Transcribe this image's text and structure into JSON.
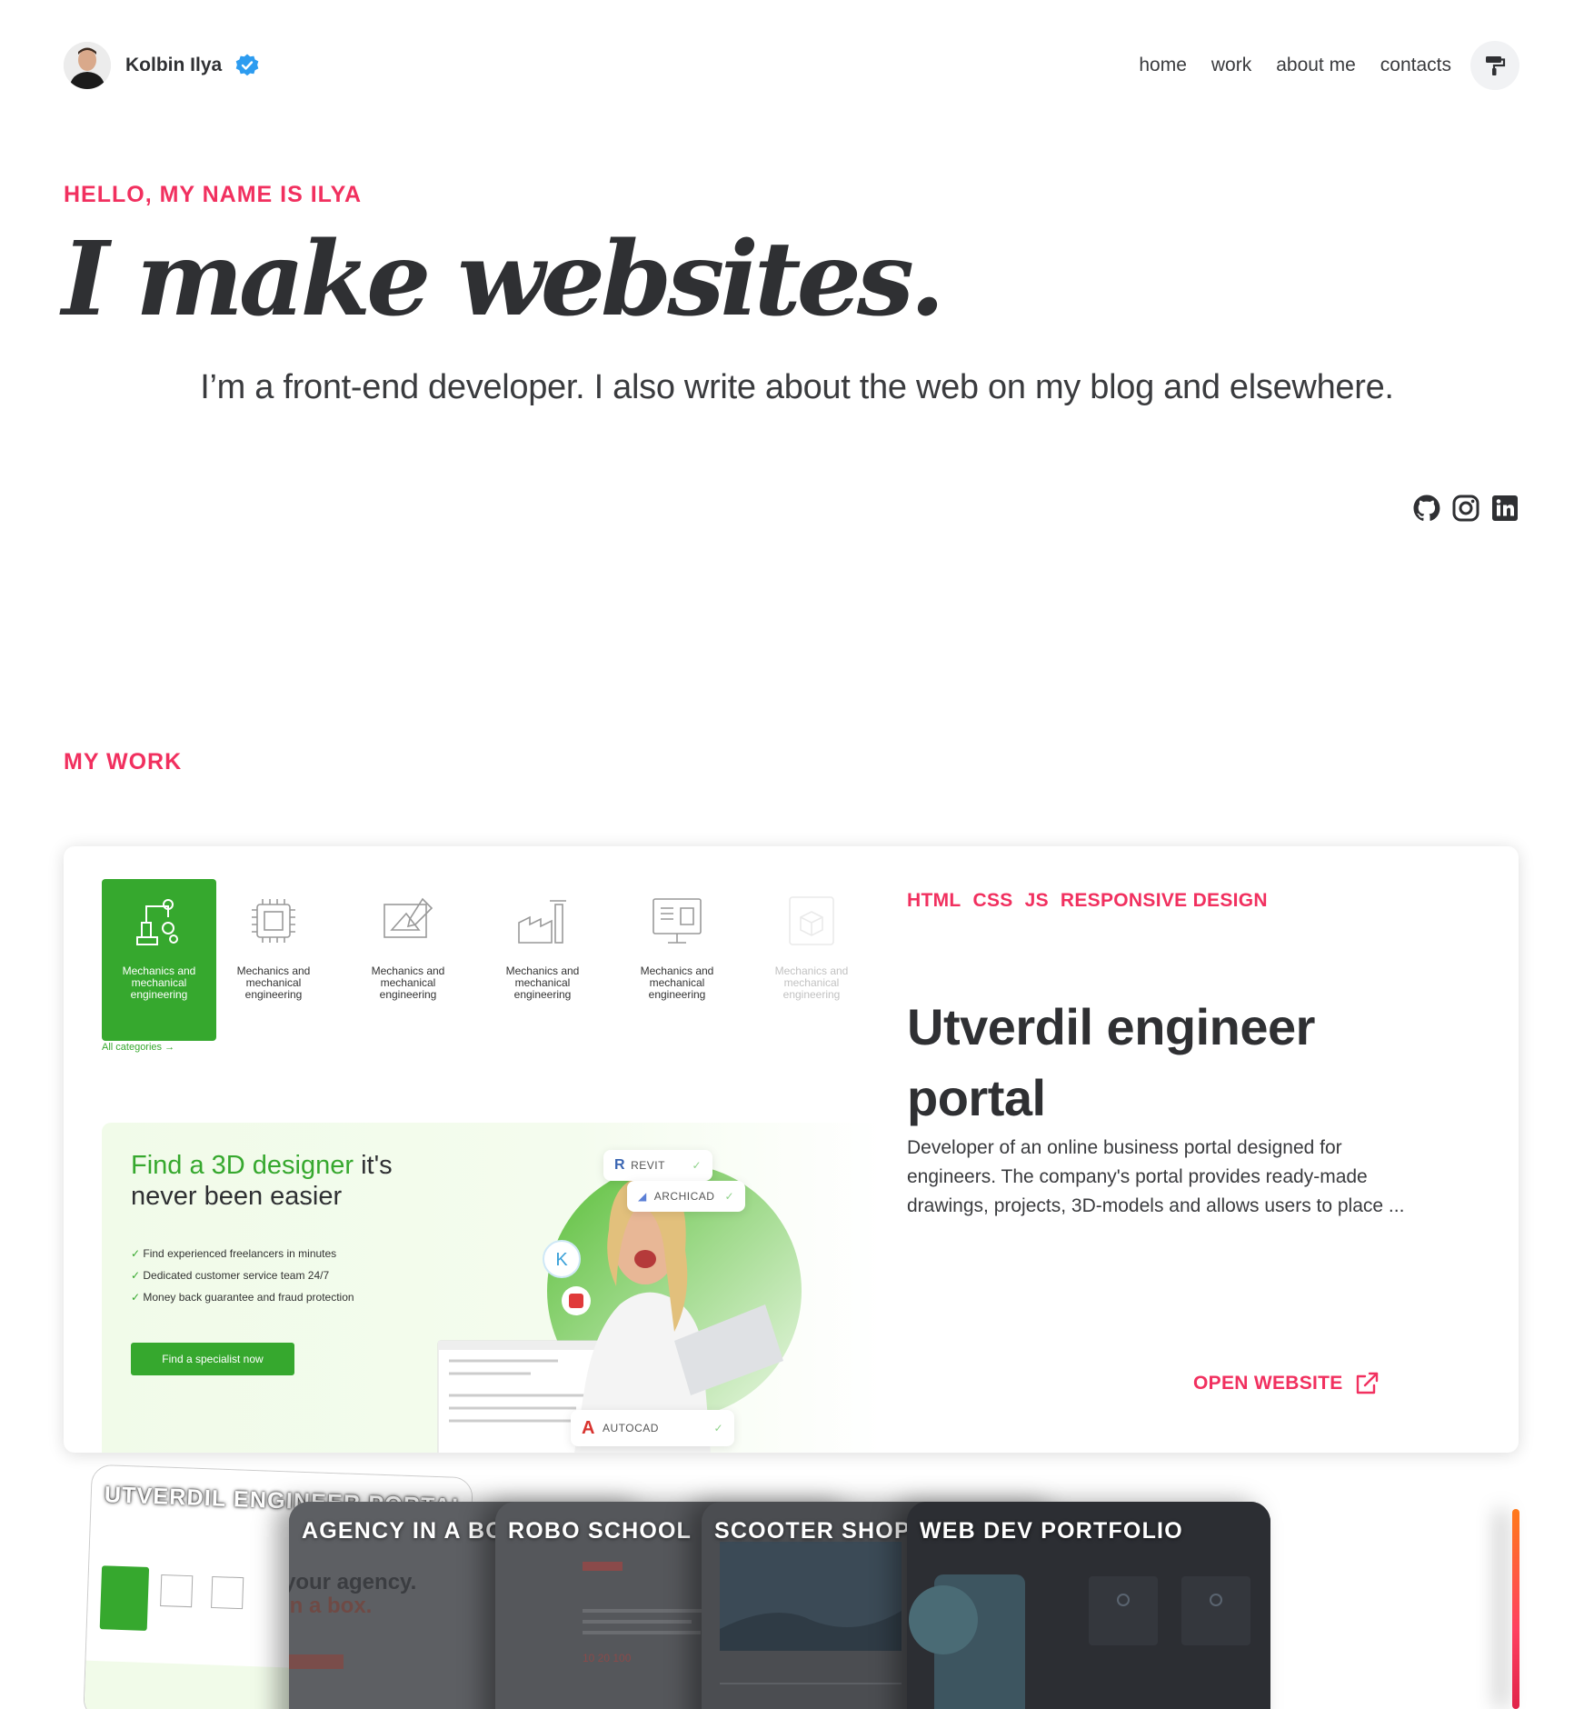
{
  "header": {
    "name": "Kolbin Ilya",
    "nav": [
      "home",
      "work",
      "about me",
      "contacts"
    ]
  },
  "hero": {
    "kicker": "HELLO, MY NAME IS ILYA",
    "title": "I make websites.",
    "subtitle": "I’m a front-end developer. I also write about the web on my blog and elsewhere."
  },
  "socials": [
    "github-icon",
    "instagram-icon",
    "linkedin-icon"
  ],
  "work": {
    "section_title": "MY WORK",
    "featured": {
      "tags": [
        "HTML",
        "CSS",
        "JS",
        "RESPONSIVE DESIGN"
      ],
      "title": "Utverdil engineer portal",
      "description": "Developer of an online business portal designed for engineers. The company's portal provides ready-made drawings, projects, 3D-models and allows users to place ...",
      "open_label": "OPEN WEBSITE",
      "preview": {
        "categories": [
          "Mechanics and mechanical engineering",
          "Mechanics and mechanical engineering",
          "Mechanics and mechanical engineering",
          "Mechanics and mechanical engineering",
          "Mechanics and mechanical engineering",
          "Mechanics and mechanical engineering"
        ],
        "all_categories": "All categories",
        "promo_title_green": "Find a 3D designer",
        "promo_title_rest": " it's never been easier",
        "promo_points": [
          "Find experienced freelancers in minutes",
          "Dedicated customer service team 24/7",
          "Money back guarantee and fraud protection"
        ],
        "promo_cta": "Find a specialist now",
        "software": [
          "REVIT",
          "ARCHICAD",
          "AUTOCAD"
        ]
      }
    },
    "carousel": [
      "UTVERDIL ENGINEER PORTAL",
      "AGENCY IN A BOX",
      "ROBO SCHOOL",
      "SCOOTER SHOP",
      "WEB DEV PORTFOLIO"
    ]
  },
  "colors": {
    "accent": "#f1305f",
    "text": "#2f3033",
    "brand_green": "#36a82e",
    "verified": "#2d9cf0"
  }
}
